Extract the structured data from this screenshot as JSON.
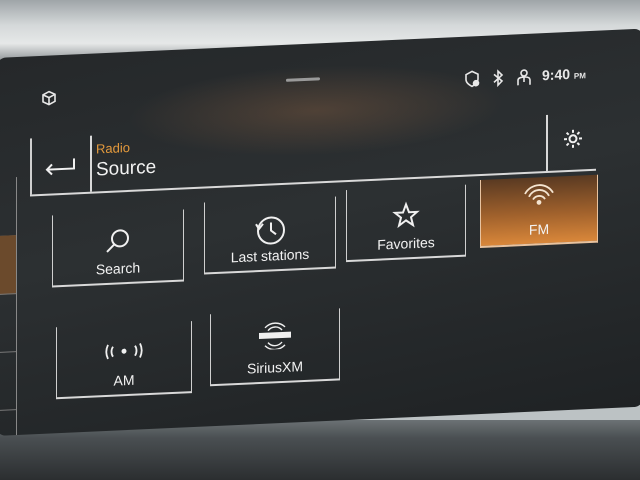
{
  "status": {
    "time": "9:40",
    "ampm": "PM",
    "icons": [
      "vehicle-cube-icon",
      "location-shield-icon",
      "bluetooth-icon",
      "driver-profile-icon"
    ]
  },
  "header": {
    "subtitle": "Radio",
    "title": "Source"
  },
  "sources": [
    {
      "label": "Search",
      "icon": "search-icon",
      "active": false
    },
    {
      "label": "Last stations",
      "icon": "history-clock-icon",
      "active": false
    },
    {
      "label": "Favorites",
      "icon": "star-icon",
      "active": false
    },
    {
      "label": "FM",
      "icon": "fm-signal-icon",
      "active": true
    },
    {
      "label": "AM",
      "icon": "am-signal-icon",
      "active": false
    },
    {
      "label": "SiriusXM",
      "icon": "siriusxm-logo-icon",
      "active": false
    }
  ],
  "colors": {
    "accent": "#e59a3c",
    "active_tile": "#d9873a",
    "screen_bg": "#2a2e30"
  }
}
